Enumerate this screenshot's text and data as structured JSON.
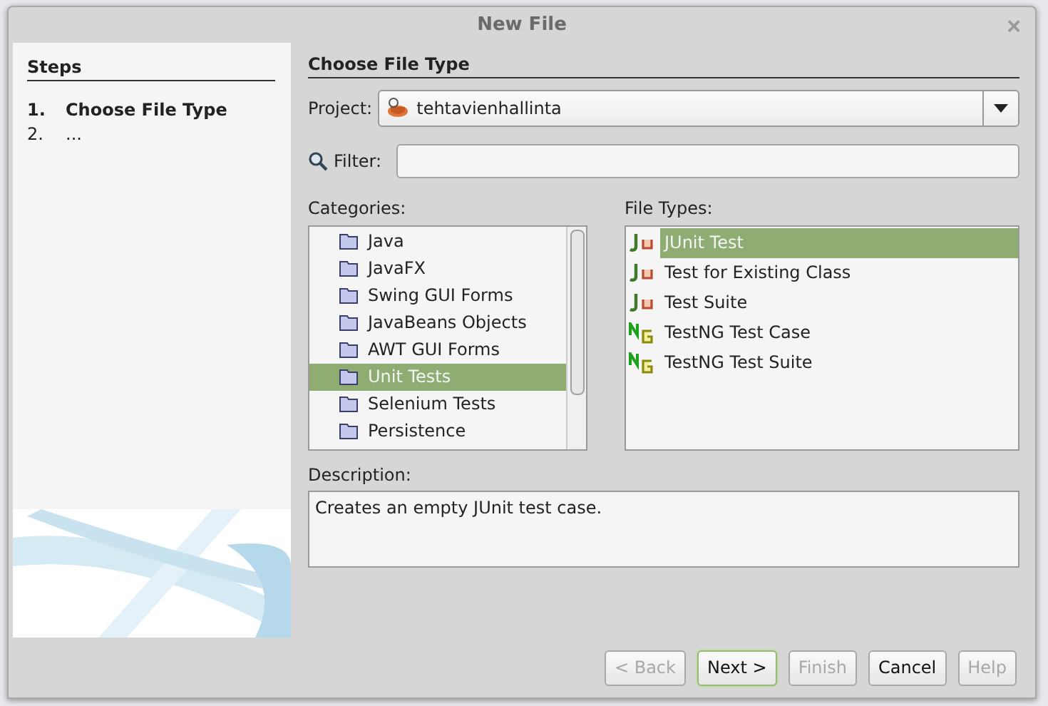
{
  "window": {
    "title": "New File",
    "close": "×"
  },
  "steps": {
    "title": "Steps",
    "items": [
      {
        "number": "1.",
        "label": "Choose File Type",
        "selected": true
      },
      {
        "number": "2.",
        "label": "...",
        "selected": false
      }
    ]
  },
  "main": {
    "title": "Choose File Type",
    "project": {
      "label": "Project:",
      "value": "tehtavienhallinta"
    },
    "filter": {
      "label": "Filter:"
    },
    "categories": {
      "label": "Categories:",
      "items": [
        {
          "label": "Java",
          "selected": false
        },
        {
          "label": "JavaFX",
          "selected": false
        },
        {
          "label": "Swing GUI Forms",
          "selected": false
        },
        {
          "label": "JavaBeans Objects",
          "selected": false
        },
        {
          "label": "AWT GUI Forms",
          "selected": false
        },
        {
          "label": "Unit Tests",
          "selected": true
        },
        {
          "label": "Selenium Tests",
          "selected": false
        },
        {
          "label": "Persistence",
          "selected": false
        }
      ]
    },
    "file_types": {
      "label": "File Types:",
      "items": [
        {
          "label": "JUnit Test",
          "kind": "junit",
          "selected": true
        },
        {
          "label": "Test for Existing Class",
          "kind": "junit",
          "selected": false
        },
        {
          "label": "Test Suite",
          "kind": "junit",
          "selected": false
        },
        {
          "label": "TestNG Test Case",
          "kind": "testng",
          "selected": false
        },
        {
          "label": "TestNG Test Suite",
          "kind": "testng",
          "selected": false
        }
      ]
    },
    "description": {
      "label": "Description:",
      "text": "Creates an empty JUnit test case."
    }
  },
  "buttons": [
    {
      "label": "< Back",
      "disabled": true,
      "default": false
    },
    {
      "label": "Next >",
      "disabled": false,
      "default": true
    },
    {
      "label": "Finish",
      "disabled": true,
      "default": false
    },
    {
      "label": "Cancel",
      "disabled": false,
      "default": false
    },
    {
      "label": "Help",
      "disabled": true,
      "default": false
    }
  ]
}
